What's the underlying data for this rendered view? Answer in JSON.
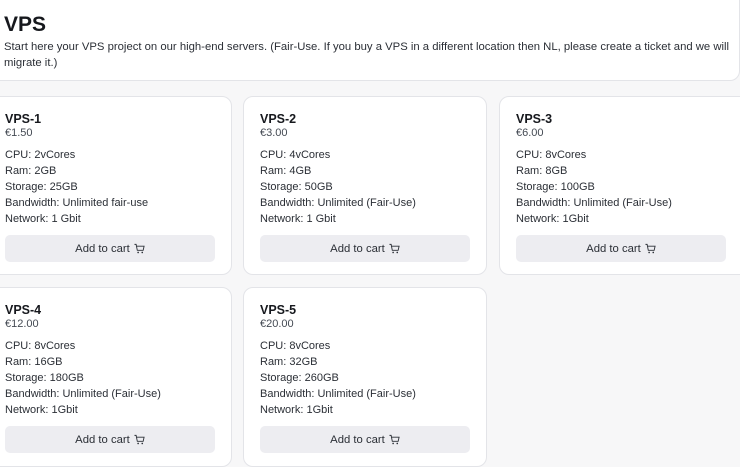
{
  "header": {
    "title": "VPS",
    "description": "Start here your VPS project on our high-end servers. (Fair-Use. If you buy a VPS in a different location then NL, please create a ticket and we will migrate it.)"
  },
  "cart_label": "Add to cart",
  "cart_icon": "shopping-cart-icon",
  "plans": [
    {
      "name": "VPS-1",
      "price": "€1.50",
      "specs": [
        "CPU: 2vCores",
        "Ram: 2GB",
        "Storage: 25GB",
        "Bandwidth: Unlimited fair-use",
        "Network: 1 Gbit"
      ]
    },
    {
      "name": "VPS-2",
      "price": "€3.00",
      "specs": [
        "CPU: 4vCores",
        "Ram: 4GB",
        "Storage: 50GB",
        "Bandwidth: Unlimited (Fair-Use)",
        "Network: 1 Gbit"
      ]
    },
    {
      "name": "VPS-3",
      "price": "€6.00",
      "specs": [
        "CPU: 8vCores",
        "Ram: 8GB",
        "Storage: 100GB",
        "Bandwidth: Unlimited (Fair-Use)",
        "Network: 1Gbit"
      ]
    },
    {
      "name": "VPS-4",
      "price": "€12.00",
      "specs": [
        "CPU: 8vCores",
        "Ram: 16GB",
        "Storage: 180GB",
        "Bandwidth: Unlimited (Fair-Use)",
        "Network: 1Gbit"
      ]
    },
    {
      "name": "VPS-5",
      "price": "€20.00",
      "specs": [
        "CPU: 8vCores",
        "Ram: 32GB",
        "Storage: 260GB",
        "Bandwidth: Unlimited (Fair-Use)",
        "Network: 1Gbit"
      ]
    }
  ]
}
